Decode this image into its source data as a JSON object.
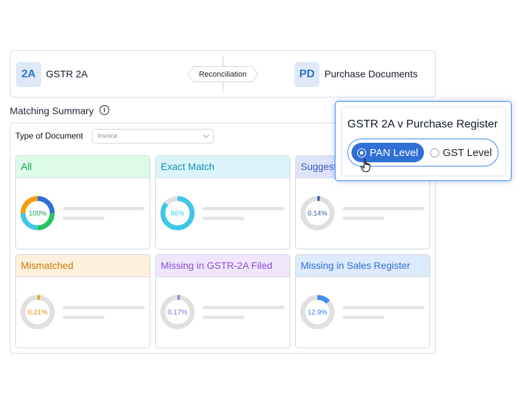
{
  "top_bar": {
    "left_badge": "2A",
    "left_label": "GSTR 2A",
    "center_label": "Reconciliation",
    "right_badge": "PD",
    "right_label": "Purchase Documents"
  },
  "summary": {
    "title": "Matching Summary",
    "info_icon": "i",
    "doc_type_label": "Type of Document",
    "doc_type_value": "Invoice"
  },
  "cards": [
    {
      "title": "All",
      "percent_label": "100%",
      "value": 100,
      "header_bg": "#dcfbe8",
      "header_color": "#16a34a",
      "text_color": "#16a34a"
    },
    {
      "title": "Exact Match",
      "percent_label": "86%",
      "value": 86,
      "header_bg": "#dcf5fb",
      "header_color": "#0e8fb0",
      "ring_color": "#3fc6e8",
      "text_color": "#3fc6e8"
    },
    {
      "title": "Suggest",
      "percent_label": "0.14%",
      "value": 0.14,
      "header_bg": "#dfe4fb",
      "header_color": "#3b56b8",
      "ring_color": "#3b56a8",
      "text_color": "#3b56a8"
    },
    {
      "title": "Mismatched",
      "percent_label": "0.21%",
      "value": 0.21,
      "header_bg": "#fdf0dc",
      "header_color": "#c87809",
      "ring_color": "#f59e0b",
      "text_color": "#d98a0a"
    },
    {
      "title": "Missing in GSTR-2A Filed",
      "percent_label": "0.17%",
      "value": 0.17,
      "header_bg": "#efe6fb",
      "header_color": "#8b4fd6",
      "ring_color": "#a277e8",
      "text_color": "#8b62d8"
    },
    {
      "title": "Missing in Sales Register",
      "percent_label": "12.9%",
      "value": 12.9,
      "header_bg": "#dceafb",
      "header_color": "#2f6fd6",
      "ring_color": "#3f8ef0",
      "text_color": "#2f80e0"
    }
  ],
  "popup": {
    "title": "GSTR 2A v Purchase Register",
    "options": [
      {
        "label": "PAN Level",
        "selected": true
      },
      {
        "label": "GST Level",
        "selected": false
      }
    ]
  },
  "colors": {
    "accent": "#2f6fd6",
    "badge_bg": "#dde9f7",
    "ring_track": "#e0e0e0"
  },
  "icons": {
    "info": "info-icon",
    "dropdown": "chevron-down-icon",
    "cursor": "hand-pointer-icon",
    "radio": "radio-icon"
  }
}
